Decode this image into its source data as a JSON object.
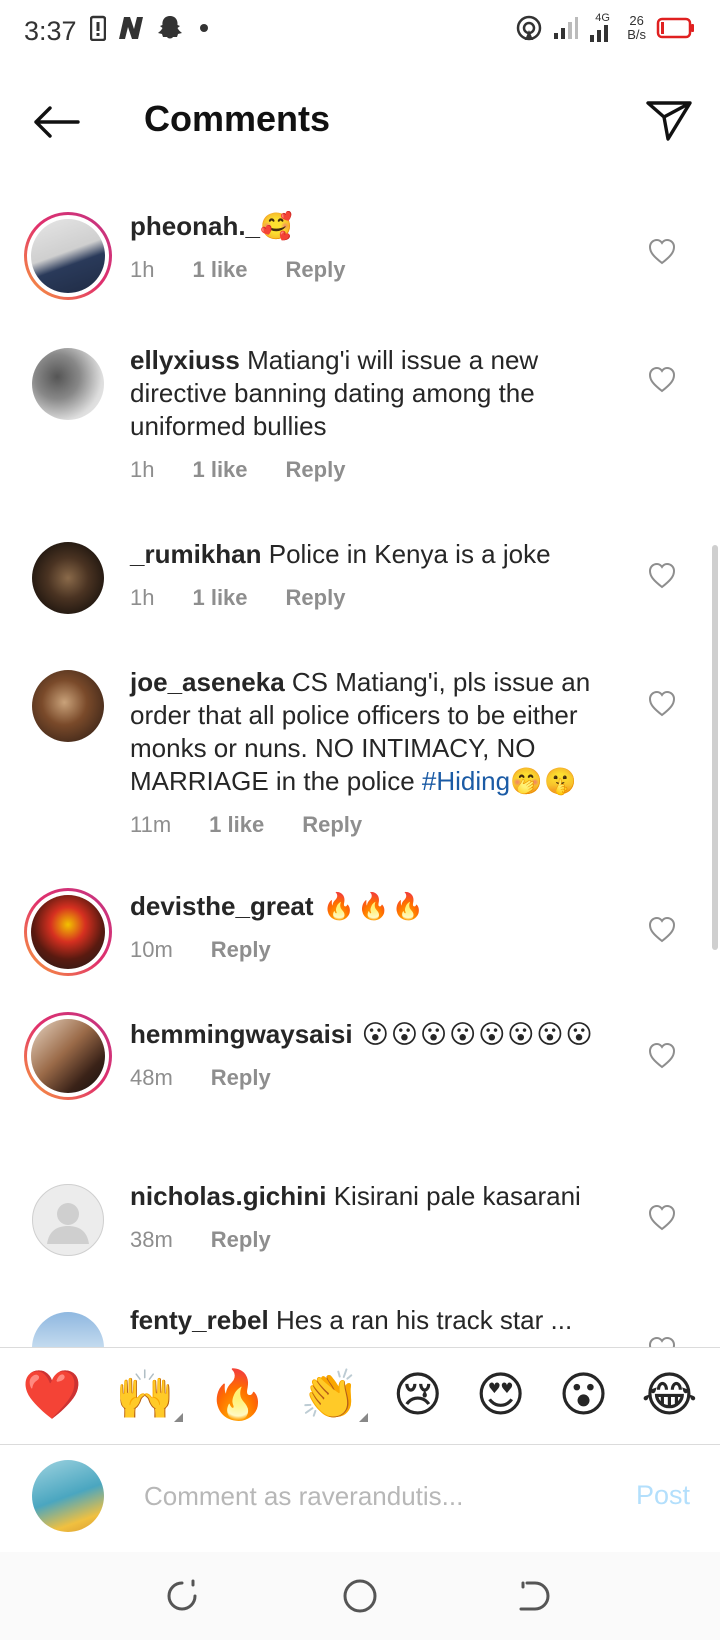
{
  "status": {
    "time": "3:37",
    "network_top": "26",
    "network_bottom": "B/s",
    "signal_label": "4G"
  },
  "header": {
    "title": "Comments"
  },
  "comments": [
    {
      "username": "pheonah._",
      "text": "",
      "emojis": "🥰",
      "time": "1h",
      "likes": "1 like",
      "reply": "Reply",
      "ring": true
    },
    {
      "username": "ellyxiuss",
      "text": " Matiang'i will issue a new directive banning dating among the uniformed bullies",
      "emojis": "",
      "time": "1h",
      "likes": "1 like",
      "reply": "Reply",
      "ring": false
    },
    {
      "username": "_rumikhan",
      "text": " Police in Kenya is a joke",
      "emojis": "",
      "time": "1h",
      "likes": "1 like",
      "reply": "Reply",
      "ring": false
    },
    {
      "username": "joe_aseneka",
      "text": " CS Matiang'i, pls issue an order that all police officers to be either monks or nuns. NO INTIMACY, NO MARRIAGE in the police ",
      "hashtag": "#Hiding",
      "emojis": "🤭🤫",
      "time": "11m",
      "likes": "1 like",
      "reply": "Reply",
      "ring": false
    },
    {
      "username": "devisthe_great",
      "text": "",
      "emojis": " 🔥🔥🔥",
      "time": "10m",
      "likes": "",
      "reply": "Reply",
      "ring": true
    },
    {
      "username": "hemmingwaysaisi",
      "text": "",
      "emojis": " 😮😮😮😮😮😮😮😮",
      "time": "48m",
      "likes": "",
      "reply": "Reply",
      "ring": true
    },
    {
      "username": "nicholas.gichini",
      "text": " Kisirani  pale kasarani",
      "emojis": "",
      "time": "38m",
      "likes": "",
      "reply": "Reply",
      "ring": false
    },
    {
      "username": "fenty_rebel",
      "text": " Hes a ran his track star ...",
      "emojis": "",
      "time": "",
      "likes": "",
      "reply": "",
      "ring": false
    }
  ],
  "reactions": [
    "❤️",
    "🙌",
    "🔥",
    "👏",
    "😢",
    "😍",
    "😮",
    "😂"
  ],
  "compose": {
    "placeholder": "Comment as raverandutis...",
    "post_label": "Post"
  },
  "colors": {
    "hashtag": "#1b5ba5",
    "post_disabled": "#b3dffc",
    "meta_gray": "#8e8e8e"
  }
}
